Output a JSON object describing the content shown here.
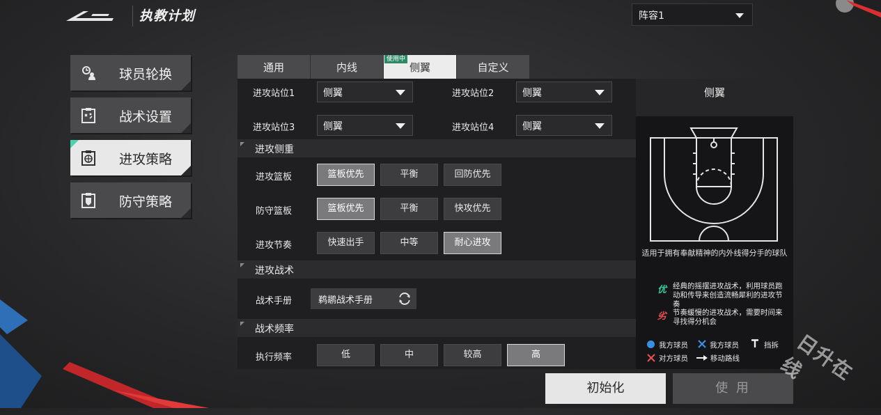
{
  "header": {
    "title": "执教计划",
    "lineup_value": "阵容1"
  },
  "nav": [
    {
      "label": "球员轮换",
      "icon": "player-rotation-icon"
    },
    {
      "label": "战术设置",
      "icon": "tactics-board-icon"
    },
    {
      "label": "进攻策略",
      "icon": "offense-basketball-icon",
      "active": true
    },
    {
      "label": "防守策略",
      "icon": "defense-shield-icon"
    }
  ],
  "tabs": [
    {
      "label": "通用"
    },
    {
      "label": "内线"
    },
    {
      "label": "侧翼",
      "active": true,
      "badge": "使用中"
    },
    {
      "label": "自定义"
    }
  ],
  "positions": [
    {
      "label": "进攻站位1",
      "value": "侧翼"
    },
    {
      "label": "进攻站位2",
      "value": "侧翼"
    },
    {
      "label": "进攻站位3",
      "value": "侧翼"
    },
    {
      "label": "进攻站位4",
      "value": "侧翼"
    }
  ],
  "focus_section": "进攻侧重",
  "rows": [
    {
      "label": "进攻篮板",
      "options": [
        "篮板优先",
        "平衡",
        "回防优先"
      ],
      "selected": 0
    },
    {
      "label": "防守篮板",
      "options": [
        "篮板优先",
        "平衡",
        "快攻优先"
      ],
      "selected": 0
    },
    {
      "label": "进攻节奏",
      "options": [
        "快速出手",
        "中等",
        "耐心进攻"
      ],
      "selected": 2
    }
  ],
  "tactics_section": "进攻战术",
  "tactic_book": {
    "label": "战术手册",
    "value": "鹈鹕战术手册"
  },
  "frequency_section": "战术频率",
  "frequency": {
    "label": "执行频率",
    "options": [
      "低",
      "中",
      "较高",
      "高"
    ],
    "selected": 3
  },
  "info": {
    "title": "侧翼",
    "caption": "适用于拥有奉献精神的内外线得分手的球队",
    "pro_icon": "优",
    "pro": "经典的摇摆进攻战术，利用球员跑动和传导来创造流畅犀利的进攻节奏",
    "con_icon": "劣",
    "con": "节奏缓慢的进攻战术，需要时间来寻找得分机会",
    "legend": [
      "我方球员",
      "我方球员",
      "挡拆",
      "对方球员",
      "移动路线"
    ]
  },
  "buttons": {
    "reset": "初始化",
    "use": "使 用"
  },
  "watermark": "日升在线",
  "colors": {
    "accent": "#4bd3b0",
    "pro": "#3cc89e",
    "con": "#e05050",
    "player": "#3b8fe0"
  }
}
